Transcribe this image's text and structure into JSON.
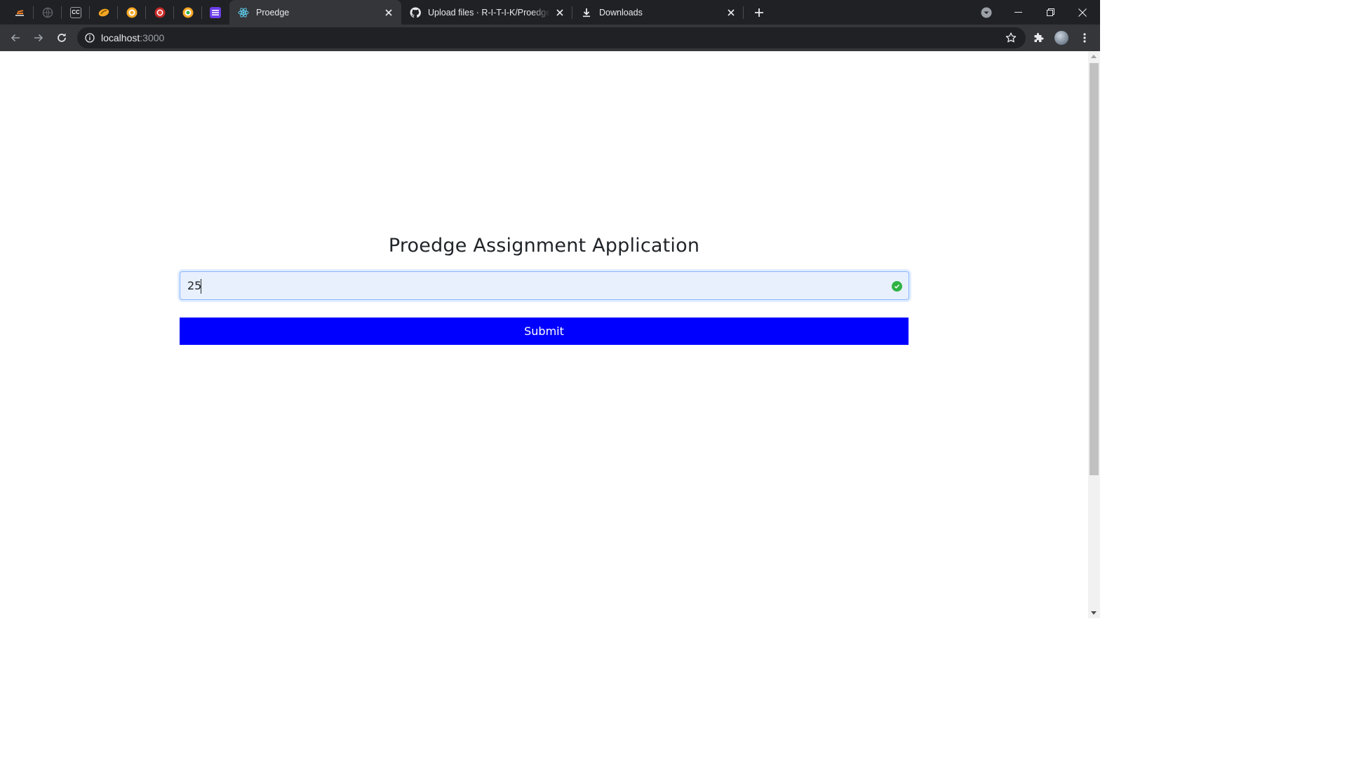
{
  "browser": {
    "pinned_tabs": [
      {
        "icon": "stack-overflow-icon",
        "color": "#f48024"
      },
      {
        "icon": "globe-icon",
        "color": "#5f6368"
      },
      {
        "icon": "cc-icon",
        "color": "#9aa0a6"
      },
      {
        "icon": "orange-logo-icon",
        "color": "#f5a623"
      },
      {
        "icon": "ring-icon",
        "color": "#f5a623"
      },
      {
        "icon": "red-ring-icon",
        "color": "#ea4335"
      },
      {
        "icon": "ring-icon",
        "color": "#f5a623"
      },
      {
        "icon": "list-icon",
        "color": "#6a3de8"
      }
    ],
    "tabs": [
      {
        "title": "Proedge",
        "icon": "react-icon",
        "active": true
      },
      {
        "title": "Upload files · R-I-T-I-K/Proedge-Assignment",
        "icon": "github-icon",
        "active": false
      },
      {
        "title": "Downloads",
        "icon": "download-icon",
        "active": false
      }
    ],
    "address": {
      "host": "localhost",
      "port": ":3000"
    }
  },
  "page": {
    "title": "Proedge Assignment Application",
    "input_value": "25",
    "submit_label": "Submit",
    "accent_color": "#0000ff",
    "valid_color": "#2fb344"
  }
}
